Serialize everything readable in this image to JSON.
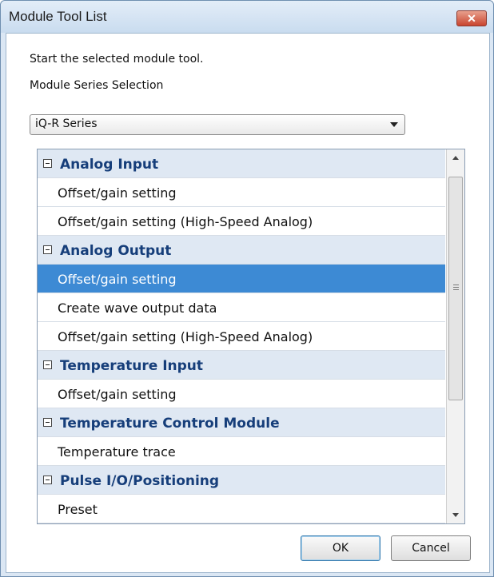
{
  "window": {
    "title": "Module Tool List",
    "close_label": "✕"
  },
  "instructions": {
    "line1": "Start the selected module tool.",
    "line2": "Module Series Selection"
  },
  "series_select": {
    "value": "iQ-R Series"
  },
  "tool_list": {
    "rows": [
      {
        "type": "group",
        "label": "Analog Input"
      },
      {
        "type": "item",
        "label": "Offset/gain setting"
      },
      {
        "type": "item",
        "label": "Offset/gain setting (High-Speed Analog)"
      },
      {
        "type": "group",
        "label": "Analog Output"
      },
      {
        "type": "item",
        "label": "Offset/gain setting",
        "selected": true
      },
      {
        "type": "item",
        "label": "Create wave output data"
      },
      {
        "type": "item",
        "label": "Offset/gain setting (High-Speed Analog)"
      },
      {
        "type": "group",
        "label": "Temperature Input"
      },
      {
        "type": "item",
        "label": "Offset/gain setting"
      },
      {
        "type": "group",
        "label": "Temperature Control Module"
      },
      {
        "type": "item",
        "label": "Temperature trace"
      },
      {
        "type": "group",
        "label": "Pulse I/O/Positioning"
      },
      {
        "type": "item",
        "label": "Preset"
      }
    ]
  },
  "buttons": {
    "ok_label": "OK",
    "cancel_label": "Cancel"
  },
  "colors": {
    "selection": "#3d8ad4",
    "group_header": "#163e7a",
    "group_bg": "#dfe8f3"
  }
}
